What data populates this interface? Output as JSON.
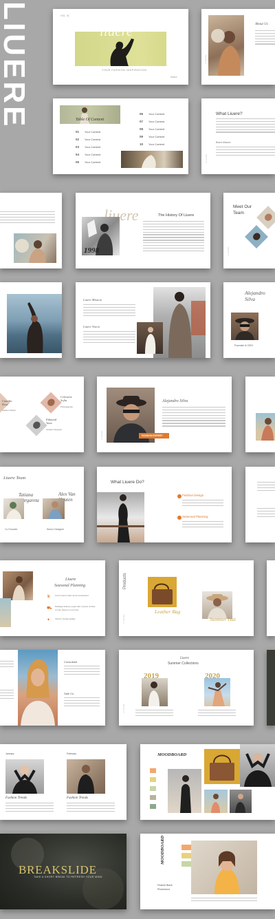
{
  "brand": {
    "wordmark": "LIUERE",
    "serif_logo": "liuere",
    "volume": "VOL. 01",
    "tagline": "YOUR FASHION INSPIRATION"
  },
  "toc": {
    "title": "Table Of Content",
    "items_left": [
      {
        "num": "01",
        "label": "Your Content"
      },
      {
        "num": "02",
        "label": "Your Content"
      },
      {
        "num": "03",
        "label": "Your Content"
      },
      {
        "num": "04",
        "label": "Your Content"
      },
      {
        "num": "05",
        "label": "Your Content"
      }
    ],
    "items_right": [
      {
        "num": "06",
        "label": "Your Content"
      },
      {
        "num": "07",
        "label": "Your Content"
      },
      {
        "num": "08",
        "label": "Your Content"
      },
      {
        "num": "09",
        "label": "Your Content"
      },
      {
        "num": "10",
        "label": "Your Content"
      }
    ]
  },
  "about": {
    "title": "About Us",
    "what_title": "What Liuere?",
    "small_head": "Brand Mission"
  },
  "history": {
    "title": "The History Of Liuere",
    "year": "1998"
  },
  "team": {
    "meet": "Meet Our Team",
    "vision": "Liuere Mission",
    "vision2": "Liuere Vision",
    "founder_name": "Alejandro Silva",
    "founder_role": "Founder & CEO",
    "members": [
      {
        "name": "Camilla Rose",
        "role": "Fashion Model"
      },
      {
        "name": "Celestine Sofia",
        "role": "Photographer"
      },
      {
        "name": "Edmund Vane",
        "role": "Graphic Designer"
      }
    ],
    "profile_name": "Alejandro Silva",
    "profile_badge": "FASHION EXPERT",
    "liuere_team": "Liuere Team",
    "lead_left_name": "Tatiana Margareta",
    "lead_left_role": "Co Founder",
    "lead_right_name": "Alex Van Houten",
    "lead_right_role": "Senior Designer"
  },
  "whatwedo": {
    "title": "What Liuere Do?",
    "item1": "Fashion Design",
    "item2": "Seasonal Planning"
  },
  "seasonal": {
    "brand": "Liuere",
    "title": "Seasonal Planning",
    "points": [
      "Lorem ipsum dolor amet consectetur.",
      "Package delivery super fast, receive clothes of your dream in one hour.",
      "Visit for trusted quality"
    ]
  },
  "products": {
    "label": "Products",
    "p1": "Leather Bag",
    "p2": "Summer Hat"
  },
  "collections": {
    "brand": "Liuere",
    "title": "Summer Collections",
    "year1": "2019",
    "year2": "2020"
  },
  "portrait": {
    "head1": "Consultant",
    "head2": "Sale Co"
  },
  "trends": {
    "month1": "January",
    "month2": "February",
    "head1": "Fashion Trends",
    "head2": "Fashion Trends"
  },
  "moodboard": {
    "title": "MOODBOARD",
    "title2": "MOODBOARD",
    "sub": "Feature Black",
    "sub2": "Photoshoot"
  },
  "closing": {
    "title": "BREAKSLIDE",
    "sub": "TAKE A SHORT BREAK TO REFRESH YOUR MIND"
  },
  "colors": {
    "accent": "#e07a2e",
    "lime": "#d5d98a",
    "gold": "#c9a64a",
    "background": "#a8a8a8"
  }
}
